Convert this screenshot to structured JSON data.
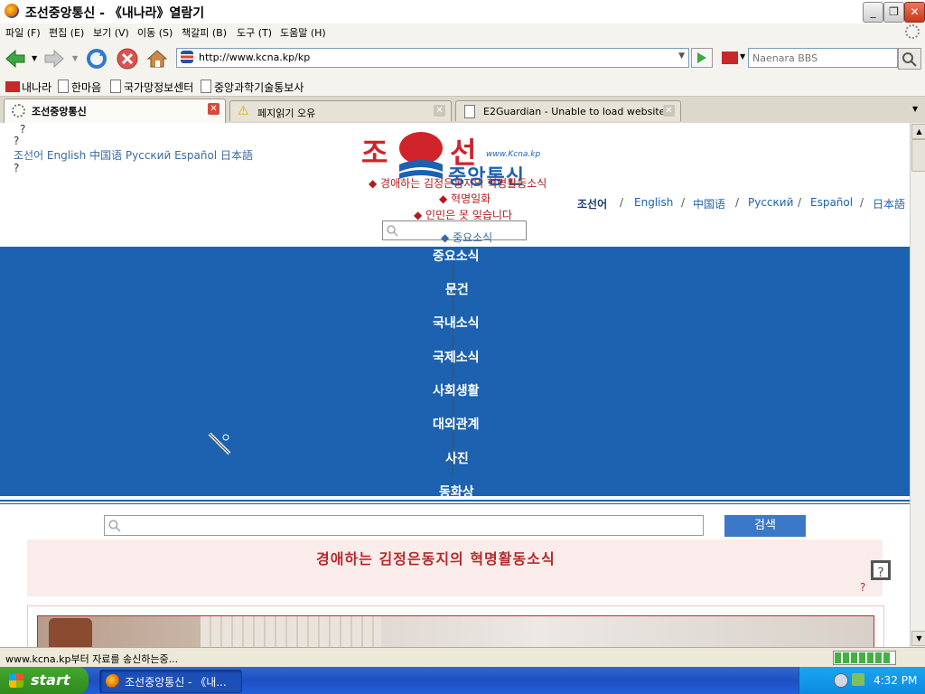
{
  "window": {
    "title": "조선중앙통신 - 《내나라》열람기",
    "min": "_",
    "max": "❐",
    "close": "✕"
  },
  "menu": [
    "파일 (F)",
    "편집 (E)",
    "보기 (V)",
    "이동 (S)",
    "책갈피 (B)",
    "도구 (T)",
    "도움말 (H)"
  ],
  "nav": {
    "url": "http://www.kcna.kp/kp",
    "search_placeholder": "Naenara BBS"
  },
  "bookmarks": [
    "내나라",
    "한마음",
    "국가망정보센터",
    "중앙과학기술통보사"
  ],
  "tabs": [
    {
      "label": "조선중앙통신",
      "active": true
    },
    {
      "label": "페지읽기 오유",
      "active": false
    },
    {
      "label": "E2Guardian - Unable to load website",
      "active": false
    }
  ],
  "page": {
    "q1": "?",
    "q2": "?",
    "q3": "?",
    "top_langs": "조선어 English 中国语 Русский Español 日本語",
    "logo_big1": "조",
    "logo_big2": "선",
    "logo_sub": "www.Kcna.kp",
    "logo_name": "중앙통신",
    "feature_links": [
      "경애하는 김정은동지의 혁명활동소식",
      "혁명일화",
      "인민은 못 잊습니다"
    ],
    "overlay_link": "중요소식",
    "lang_links": [
      "조선어",
      "English",
      "中国语",
      "Русский",
      "Español",
      "日本語"
    ],
    "lang_sep": "/",
    "blue_nav": [
      "중요소식",
      "문건",
      "국내소식",
      "국제소식",
      "사회생활",
      "대외관계",
      "사진",
      "동화상"
    ],
    "search_button": "검색",
    "headline": "경애하는 김정은동지의 혁명활동소식",
    "headline_q": "?",
    "headline_q2": "?"
  },
  "status": {
    "text": "www.kcna.kp부터 자료를 송신하는중..."
  },
  "taskbar": {
    "start": "start",
    "window": "조선중앙통신 - 《내...",
    "clock": "4:32 PM"
  },
  "colors": {
    "blue_bar": "#1c62b0",
    "headline": "#b52a2a",
    "headline_bg": "#fbecec"
  }
}
